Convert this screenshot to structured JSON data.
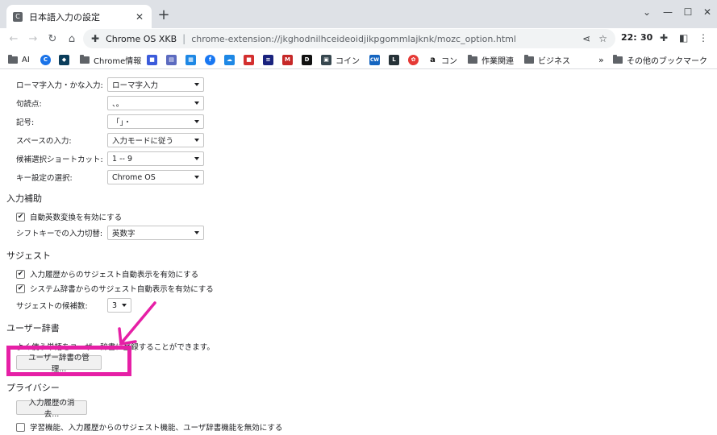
{
  "browser": {
    "tab": {
      "title": "日本語入力の設定",
      "favicon": "C"
    },
    "omnibox": {
      "site": "Chrome OS XKB",
      "url": "chrome-extension://jkghodnilhceideoidjikpgommlajknk/mozc_option.html"
    },
    "toolbar_right": {
      "hour": "22:",
      "minute": "30"
    }
  },
  "bookmarks": [
    {
      "label": "AI",
      "type": "folder"
    },
    {
      "label": "",
      "type": "site",
      "color": "#1a73e8",
      "glyph": "C"
    },
    {
      "label": "",
      "type": "site",
      "color": "#0b3d5b",
      "glyph": "◆"
    },
    {
      "label": "Chrome情報",
      "type": "folder"
    },
    {
      "label": "",
      "type": "site",
      "color": "#3b5bdb",
      "glyph": "■"
    },
    {
      "label": "",
      "type": "site",
      "color": "#5c6bc0",
      "glyph": "▤"
    },
    {
      "label": "",
      "type": "site",
      "color": "#1e88e5",
      "glyph": "▦"
    },
    {
      "label": "",
      "type": "site",
      "color": "#1877f2",
      "glyph": "f"
    },
    {
      "label": "",
      "type": "site",
      "color": "#1e88e5",
      "glyph": "☁"
    },
    {
      "label": "",
      "type": "site",
      "color": "#d32f2f",
      "glyph": "■"
    },
    {
      "label": "",
      "type": "site",
      "color": "#1a237e",
      "glyph": "≡"
    },
    {
      "label": "",
      "type": "site",
      "color": "#c62828",
      "glyph": "M"
    },
    {
      "label": "",
      "type": "site",
      "color": "#111111",
      "glyph": "D"
    },
    {
      "label": "コイン",
      "type": "site",
      "color": "#37474f",
      "glyph": "▣"
    },
    {
      "label": "",
      "type": "site",
      "color": "#1565c0",
      "glyph": "CW"
    },
    {
      "label": "",
      "type": "site",
      "color": "#263238",
      "glyph": "L"
    },
    {
      "label": "",
      "type": "site",
      "color": "#e53935",
      "glyph": "✿"
    },
    {
      "label": "コン",
      "type": "site",
      "color": "#ffffff",
      "glyph": "a"
    },
    {
      "label": "作業関連",
      "type": "folder"
    },
    {
      "label": "ビジネス",
      "type": "folder"
    },
    {
      "label": "»",
      "type": "overflow"
    },
    {
      "label": "その他のブックマーク",
      "type": "folder"
    }
  ],
  "settings": {
    "rows": [
      {
        "label": "ローマ字入力・かな入力:",
        "value": "ローマ字入力"
      },
      {
        "label": "句読点:",
        "value": "、。"
      },
      {
        "label": "記号:",
        "value": "「」・"
      },
      {
        "label": "スペースの入力:",
        "value": "入力モードに従う"
      },
      {
        "label": "候補選択ショートカット:",
        "value": "1 -- 9"
      },
      {
        "label": "キー設定の選択:",
        "value": "Chrome OS"
      }
    ],
    "input_assist": {
      "title": "入力補助",
      "auto_alnum": {
        "label": "自動英数変換を有効にする",
        "checked": true
      },
      "shift_switch": {
        "label": "シフトキーでの入力切替:",
        "value": "英数字"
      }
    },
    "suggest": {
      "title": "サジェスト",
      "history": {
        "label": "入力履歴からのサジェスト自動表示を有効にする",
        "checked": true
      },
      "system_dict": {
        "label": "システム辞書からのサジェスト自動表示を有効にする",
        "checked": true
      },
      "count": {
        "label": "サジェストの候補数:",
        "value": "3"
      }
    },
    "user_dict": {
      "title": "ユーザー辞書",
      "description": "よく使う単語をユーザー辞書に登録することができます。",
      "manage_button": "ユーザー辞書の管理..."
    },
    "privacy": {
      "title": "プライバシー",
      "clear_button": "入力履歴の消去...",
      "disable": {
        "label": "学習機能、入力履歴からのサジェスト機能、ユーザ辞書機能を無効にする",
        "checked": false
      }
    }
  },
  "annotation": {
    "color": "#e61fa6"
  }
}
